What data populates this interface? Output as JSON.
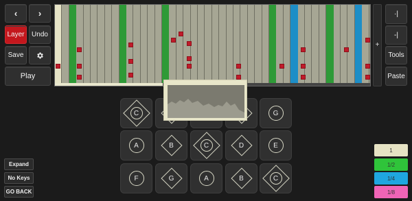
{
  "toolbar": {
    "prev_arrow": "‹",
    "next_arrow": "›",
    "layer_label": "Layer",
    "undo_label": "Undo",
    "save_label": "Save",
    "play_label": "Play"
  },
  "right_toolbar": {
    "jump_start_label": "·|",
    "jump_end_label": "-|",
    "tools_label": "Tools",
    "paste_label": "Paste",
    "add_label": "+"
  },
  "pads": [
    {
      "label": "C",
      "shape": "circle-in-diamond"
    },
    {
      "label": "",
      "shape": "diamond"
    },
    {
      "label": "",
      "shape": "circle"
    },
    {
      "label": "",
      "shape": "diamond"
    },
    {
      "label": "G",
      "shape": "circle"
    },
    {
      "label": "A",
      "shape": "circle"
    },
    {
      "label": "B",
      "shape": "diamond"
    },
    {
      "label": "C",
      "shape": "circle-in-diamond"
    },
    {
      "label": "D",
      "shape": "diamond"
    },
    {
      "label": "E",
      "shape": "circle"
    },
    {
      "label": "F",
      "shape": "circle"
    },
    {
      "label": "G",
      "shape": "diamond"
    },
    {
      "label": "A",
      "shape": "circle"
    },
    {
      "label": "B",
      "shape": "diamond"
    },
    {
      "label": "C",
      "shape": "circle-in-diamond"
    }
  ],
  "side_buttons": {
    "expand_label": "Expand",
    "no_keys_label": "No Keys",
    "go_back_label": "GO BACK"
  },
  "speed_buttons": [
    {
      "label": "1",
      "color": "#e6e3c4"
    },
    {
      "label": "1/2",
      "color": "#2fc43a"
    },
    {
      "label": "1/4",
      "color": "#1fa6e0"
    },
    {
      "label": "1/8",
      "color": "#f064b6"
    }
  ],
  "colors": {
    "accent_red": "#c4171d",
    "grid_green": "#2e9a37",
    "grid_blue": "#1d8ec7",
    "note_red": "#c01b2a"
  }
}
